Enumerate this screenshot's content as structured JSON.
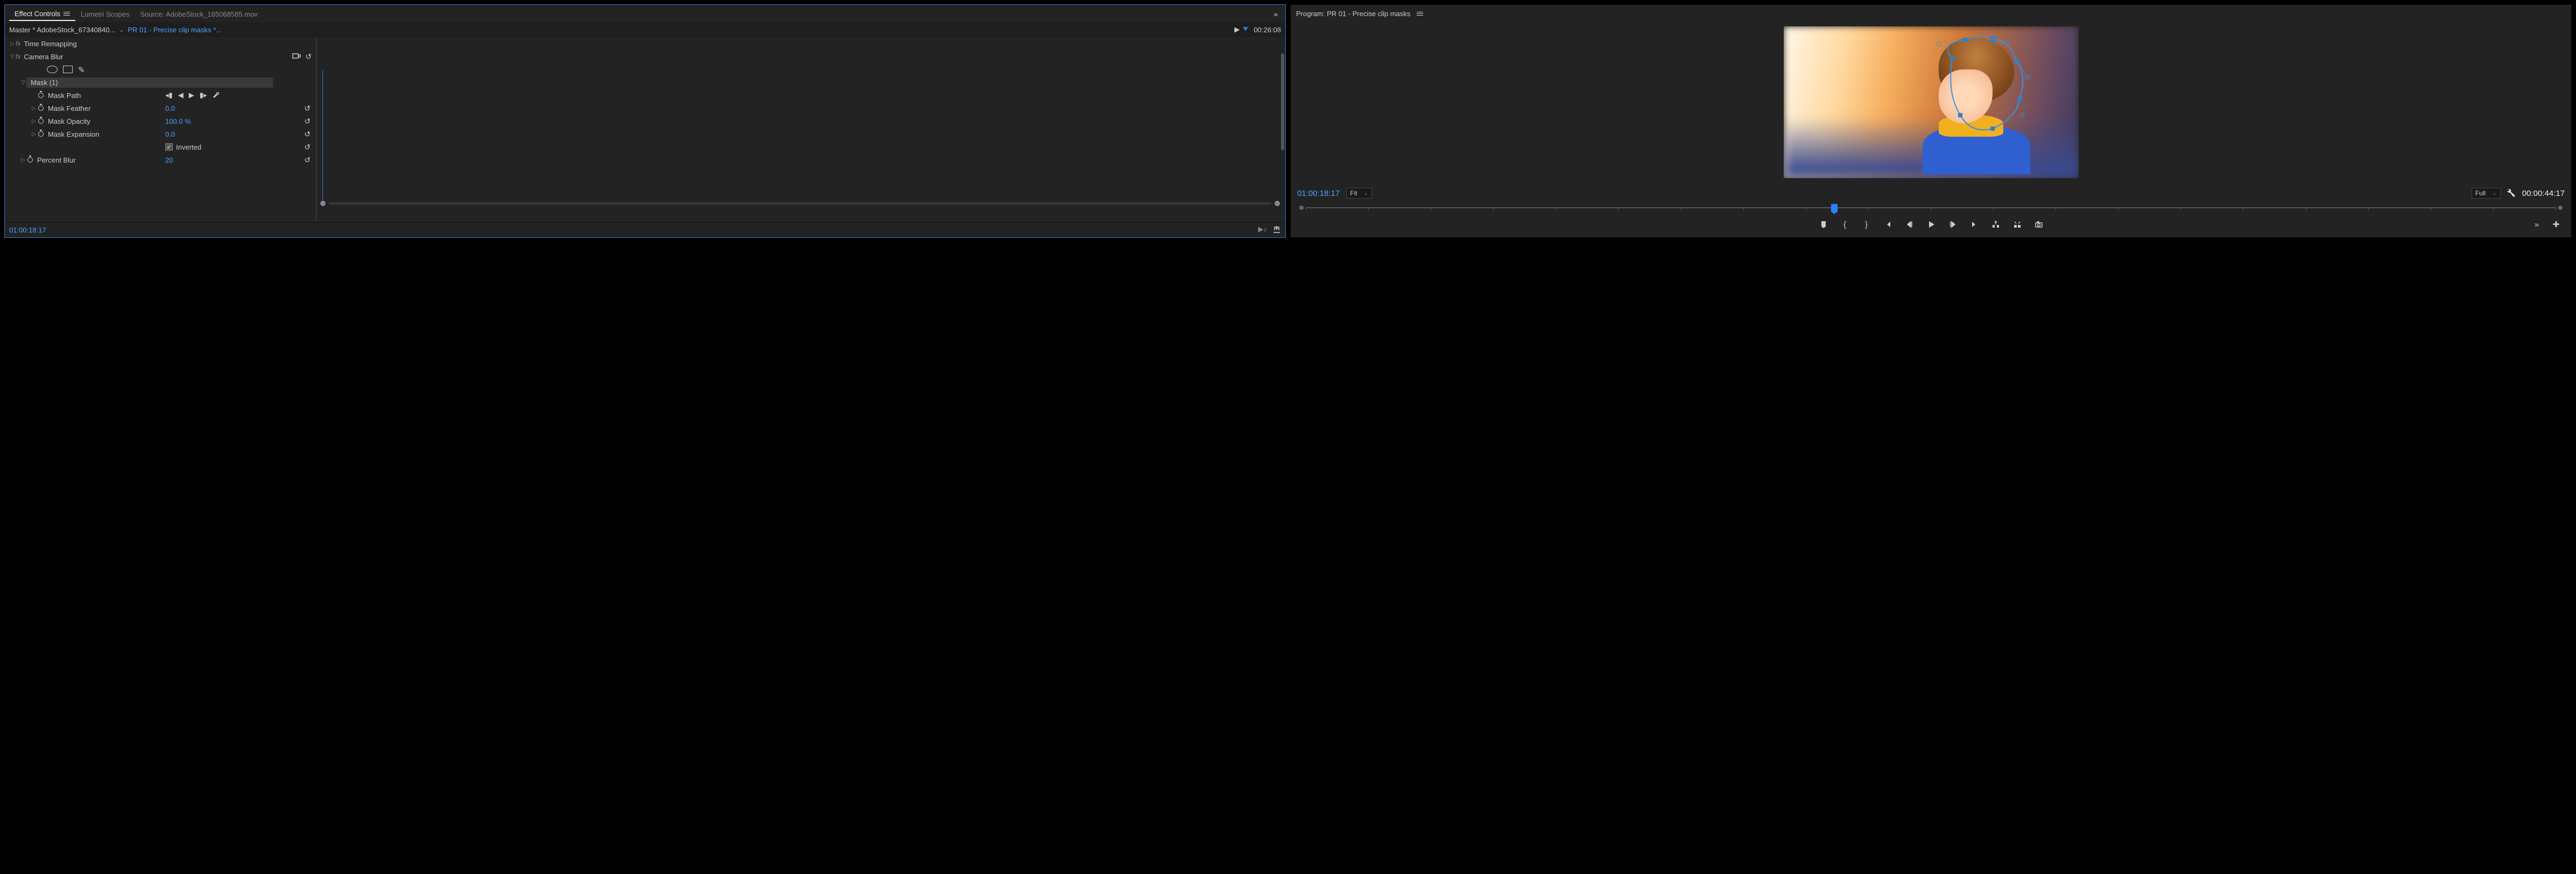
{
  "tabs": {
    "effect_controls": "Effect Controls",
    "lumetri_scopes": "Lumetri Scopes",
    "source": "Source: AdobeStock_165068585.mov"
  },
  "ec_header": {
    "master": "Master * AdobeStock_67340840...",
    "sequence": "PR 01 - Precise clip masks *...",
    "timecode": "00:26:08"
  },
  "effects": {
    "time_remapping": "Time Remapping",
    "camera_blur": {
      "label": "Camera Blur",
      "mask_label": "Mask (1)",
      "mask_path": "Mask Path",
      "mask_feather": {
        "label": "Mask Feather",
        "value": "0.0"
      },
      "mask_opacity": {
        "label": "Mask Opacity",
        "value": "100.0 %"
      },
      "mask_expansion": {
        "label": "Mask Expansion",
        "value": "0.0"
      },
      "inverted": {
        "label": "Inverted",
        "checked": true
      },
      "percent_blur": {
        "label": "Percent Blur",
        "value": "20"
      }
    }
  },
  "ec_footer_timecode": "01:00:18:17",
  "program": {
    "title": "Program: PR 01 - Precise clip masks",
    "timecode_current": "01:00:18:17",
    "timecode_duration": "00:00:44:17",
    "zoom": "Fit",
    "resolution": "Full"
  }
}
